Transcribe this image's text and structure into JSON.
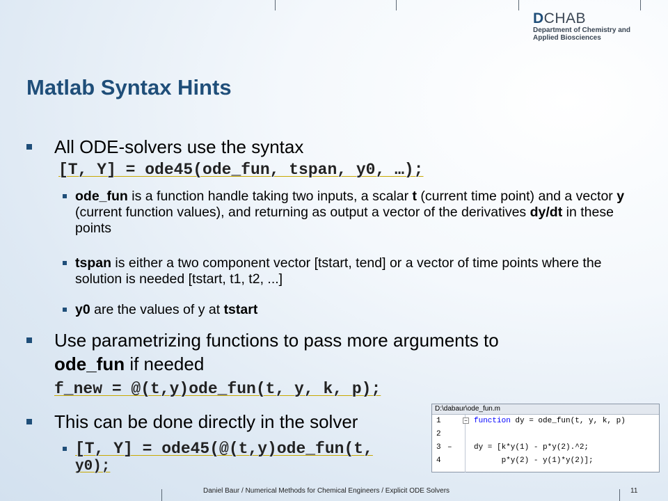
{
  "logo": {
    "big_bold": "D",
    "big_rest": "CHAB",
    "line1": "Department of Chemistry and",
    "line2": "Applied Biosciences"
  },
  "title": "Matlab Syntax Hints",
  "bullets": {
    "b1_text": "All ODE-solvers use the syntax",
    "b1_code": "[T, Y] = ode45(ode_fun, tspan, y0, …);",
    "sub1": {
      "bold1": "ode_fun",
      "t1": " is a function handle taking two inputs, a scalar ",
      "bold2": "t",
      "t2": " (current time point) and a vector ",
      "bold3": "y",
      "t3": " (current function values), and returning as output a vector of the derivatives ",
      "bold4": "dy/dt",
      "t4": " in these points"
    },
    "sub2": {
      "bold1": "tspan",
      "t1": " is either a two component vector [tstart, tend] or a vector of time points where the solution is needed [tstart, t1, t2, ...]"
    },
    "sub3": {
      "bold1": "y0",
      "t1": " are the values of y at ",
      "bold2": "tstart"
    },
    "b2_line1": "Use parametrizing functions to pass more arguments to",
    "b2_bold": "ode_fun",
    "b2_rest": " if needed",
    "b2_code": "f_new = @(t,y)ode_fun(t, y, k, p);",
    "b3_text": "This can be done directly in the solver",
    "b3_code1": "[T, Y] = ode45(@(t,y)ode_fun(t,",
    "b3_code2": "y0);"
  },
  "editor": {
    "path": "D:\\dabaur\\ode_fun.m",
    "lines": [
      {
        "num": "1",
        "mark": "",
        "kw": "function",
        "code": " dy = ode_fun(t, y, k, p)"
      },
      {
        "num": "2",
        "mark": "",
        "kw": "",
        "code": ""
      },
      {
        "num": "3",
        "mark": "–",
        "kw": "",
        "code": "dy = [k*y(1) - p*y(2).^2;"
      },
      {
        "num": "4",
        "mark": "",
        "kw": "",
        "code": "      p*y(2) - y(1)*y(2)];"
      }
    ]
  },
  "footer": {
    "text": "Daniel Baur / Numerical Methods for Chemical Engineers / Explicit ODE Solvers",
    "page": "11"
  }
}
